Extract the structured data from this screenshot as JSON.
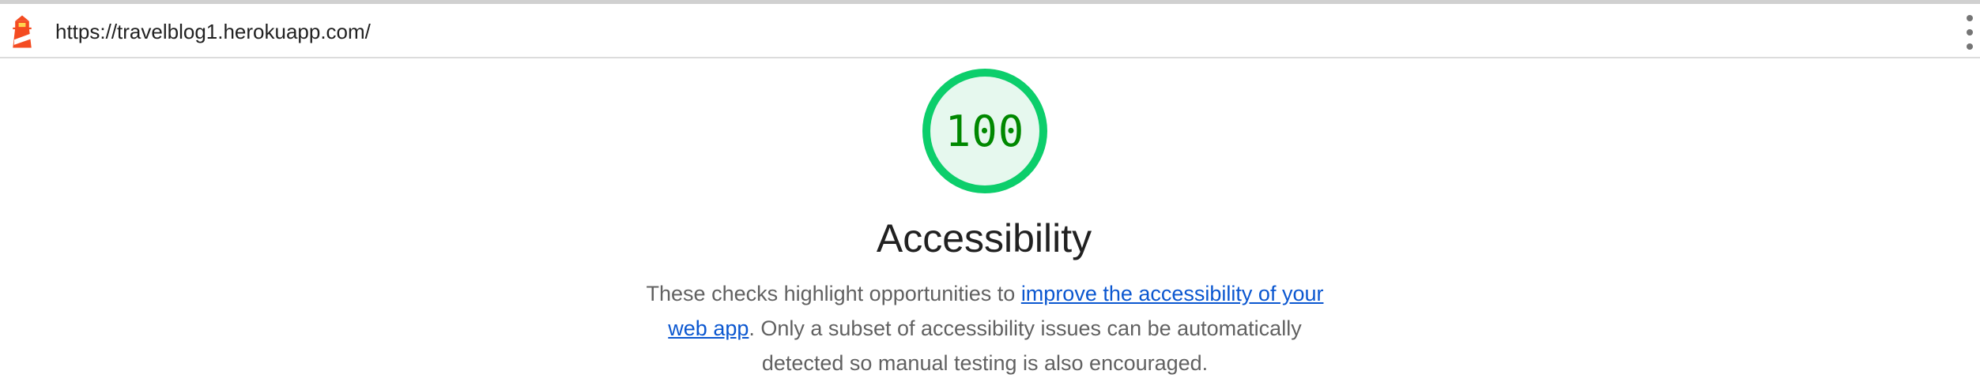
{
  "browser": {
    "url": "https://travelblog1.herokuapp.com/",
    "logo_icon": "lighthouse-icon",
    "menu_icon": "kebab-menu-icon"
  },
  "gauge": {
    "score": "100",
    "score_fraction": 1.0,
    "ring_color": "#0cce6b",
    "fill_color": "#e6f8ee",
    "text_color": "#008800"
  },
  "category": {
    "title": "Accessibility",
    "description_prefix": "These checks highlight opportunities to ",
    "description_link": "improve the accessibility of your web app",
    "description_suffix": ". Only a subset of accessibility issues can be automatically detected so manual testing is also encouraged.",
    "link_color": "#0b57d0"
  }
}
